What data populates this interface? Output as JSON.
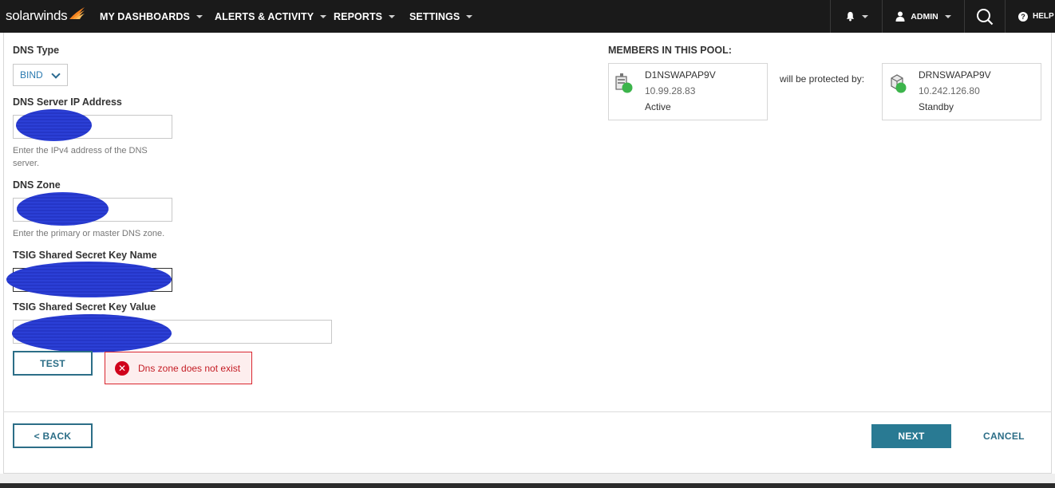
{
  "brand": {
    "logo_text": "solarwinds"
  },
  "nav": {
    "items": [
      "MY DASHBOARDS",
      "ALERTS & ACTIVITY",
      "REPORTS",
      "SETTINGS"
    ],
    "admin_label": "ADMIN",
    "help_label": "HELP"
  },
  "form": {
    "dns_type_label": "DNS Type",
    "dns_type_value": "BIND",
    "dns_server_label": "DNS Server IP Address",
    "dns_server_hint": "Enter the IPv4 address of the DNS server.",
    "dns_zone_label": "DNS Zone",
    "dns_zone_hint": "Enter the primary or master DNS zone.",
    "tsig_name_label": "TSIG Shared Secret Key Name",
    "tsig_value_label": "TSIG Shared Secret Key Value",
    "test_button": "TEST",
    "error_message": "Dns zone does not exist"
  },
  "pool": {
    "title": "MEMBERS IN THIS POOL:",
    "protected_text": "will be protected by:",
    "members": [
      {
        "name": "D1NSWAPAP9V",
        "ip": "10.99.28.83",
        "status": "Active"
      },
      {
        "name": "DRNSWAPAP9V",
        "ip": "10.242.126.80",
        "status": "Standby"
      }
    ]
  },
  "footer": {
    "back_button": "< BACK",
    "next_button": "NEXT",
    "cancel_button": "CANCEL"
  },
  "colors": {
    "nav_bg": "#1a1a1a",
    "accent": "#297a93",
    "error": "#d0021b",
    "status_ok": "#3cb44b",
    "redaction": "#2b3fd6"
  }
}
